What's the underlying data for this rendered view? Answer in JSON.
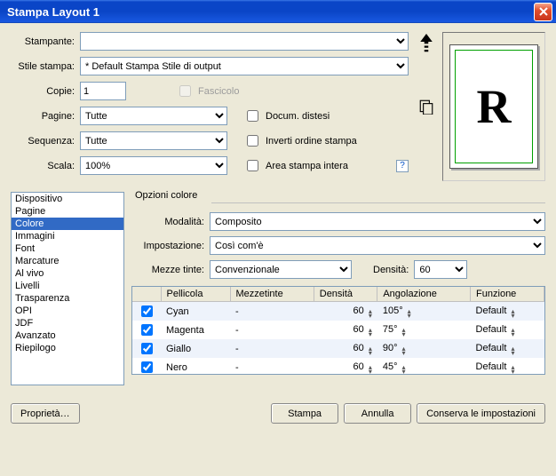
{
  "title": "Stampa Layout 1",
  "labels": {
    "stampante": "Stampante:",
    "stile": "Stile stampa:",
    "copie": "Copie:",
    "pagine": "Pagine:",
    "sequenza": "Sequenza:",
    "scala": "Scala:",
    "fascicolo": "Fascicolo",
    "docum": "Docum. distesi",
    "inverti": "Inverti ordine stampa",
    "area": "Area stampa intera",
    "opzioni": "Opzioni colore",
    "modalita": "Modalità:",
    "impostazione": "Impostazione:",
    "mezzetinte": "Mezze tinte:",
    "densita": "Densità:"
  },
  "values": {
    "stampante": "",
    "stile": "* Default Stampa Stile di output",
    "copie": "1",
    "pagine": "Tutte",
    "sequenza": "Tutte",
    "scala": "100%",
    "modalita": "Composito",
    "impostazione": "Così com'è",
    "mezzetinte": "Convenzionale",
    "densita": "60"
  },
  "preview_letter": "R",
  "listbox": {
    "items": [
      "Dispositivo",
      "Pagine",
      "Colore",
      "Immagini",
      "Font",
      "Marcature",
      "Al vivo",
      "Livelli",
      "Trasparenza",
      "OPI",
      "JDF",
      "Avanzato",
      "Riepilogo"
    ],
    "selected_index": 2
  },
  "table": {
    "headers": [
      "",
      "Pellicola",
      "Mezzetinte",
      "Densità",
      "Angolazione",
      "Funzione"
    ],
    "rows": [
      {
        "chk": true,
        "pellicola": "Cyan",
        "mezze": "-",
        "dens": "60",
        "ang": "105°",
        "funz": "Default"
      },
      {
        "chk": true,
        "pellicola": "Magenta",
        "mezze": "-",
        "dens": "60",
        "ang": "75°",
        "funz": "Default"
      },
      {
        "chk": true,
        "pellicola": "Giallo",
        "mezze": "-",
        "dens": "60",
        "ang": "90°",
        "funz": "Default"
      },
      {
        "chk": true,
        "pellicola": "Nero",
        "mezze": "-",
        "dens": "60",
        "ang": "45°",
        "funz": "Default"
      }
    ]
  },
  "buttons": {
    "proprieta": "Proprietà…",
    "stampa": "Stampa",
    "annulla": "Annulla",
    "conserva": "Conserva le impostazioni"
  }
}
